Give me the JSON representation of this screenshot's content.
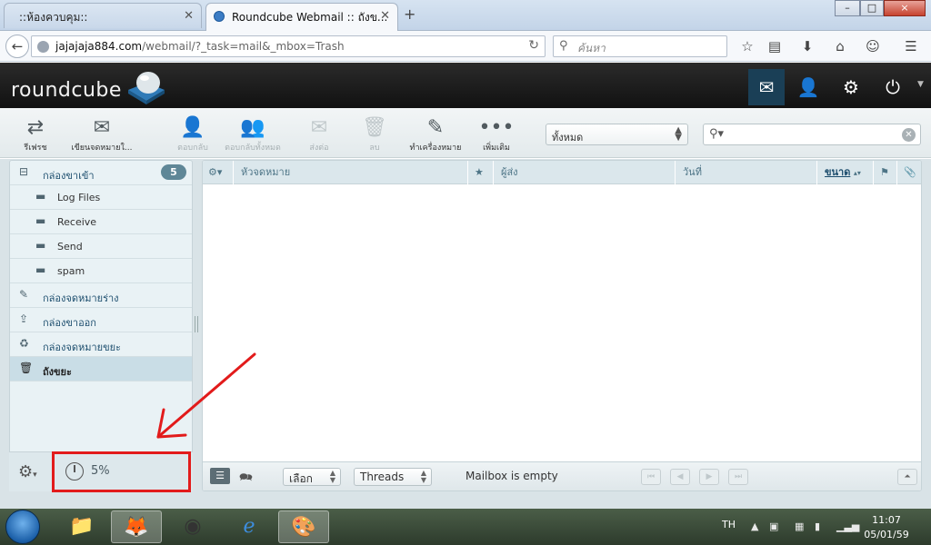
{
  "browser": {
    "tabs": [
      {
        "label": "::ห้องควบคุม::"
      },
      {
        "label": "Roundcube Webmail :: ถังข..."
      }
    ],
    "new_tab": "+",
    "window_controls": {
      "minimize": "–",
      "maximize": "□",
      "close": "×"
    },
    "url_prefix": "jajajaja884.com",
    "url_rest": "/webmail/?_task=mail&_mbox=Trash",
    "search_placeholder": "ค้นหา"
  },
  "app": {
    "logo_text": "roundcube",
    "toolbar": {
      "refresh": "รีเฟรช",
      "compose": "เขียนจดหมายใ...",
      "reply": "ตอบกลับ",
      "reply_all": "ตอบกลับทั้งหมด",
      "forward": "ส่งต่อ",
      "delete": "ลบ",
      "mark": "ทำเครื่องหมาย",
      "more": "เพิ่มเติม"
    },
    "filter_value": "ทั้งหมด",
    "folders": [
      {
        "label": "กล่องขาเข้า",
        "count": "5"
      },
      {
        "label": "Log Files"
      },
      {
        "label": "Receive"
      },
      {
        "label": "Send"
      },
      {
        "label": "spam"
      },
      {
        "label": "กล่องจดหมายร่าง"
      },
      {
        "label": "กล่องขาออก"
      },
      {
        "label": "กล่องจดหมายขยะ"
      },
      {
        "label": "ถังขยะ"
      }
    ],
    "quota": "5%",
    "list_columns": {
      "subject": "หัวจดหมาย",
      "from": "ผู้ส่ง",
      "date": "วันที่",
      "size": "ขนาด"
    },
    "footer": {
      "select": "เลือก",
      "threads": "Threads",
      "status": "Mailbox is empty"
    }
  },
  "taskbar": {
    "lang": "TH",
    "time": "11:07",
    "date": "05/01/59"
  },
  "colors": {
    "annotation": "#e21b1b",
    "header_bg": "#1e1e1e",
    "selected_nav": "#1a3f56"
  }
}
